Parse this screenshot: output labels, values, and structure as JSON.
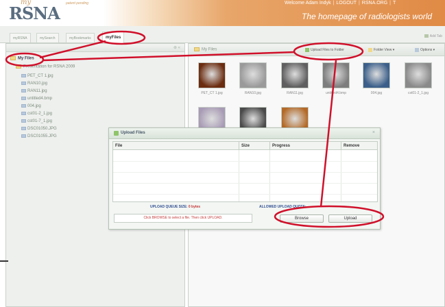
{
  "header": {
    "logo_my": "my",
    "logo_rsna": "RSNA",
    "patent": "patent pending",
    "welcome": "Welcome Adam Indyk",
    "logout": "LOGOUT",
    "rsna_org": "RSNA.ORG",
    "more": "T",
    "tagline": "The homepage of radiologists world"
  },
  "tabs": [
    {
      "label": "myRSNA"
    },
    {
      "label": "mySearch"
    },
    {
      "label": "myBookmarks"
    },
    {
      "label": "myFiles"
    }
  ],
  "add_tab": "Add Tab",
  "left_panel": {
    "root": "My Files",
    "folder": "Presentation for RSNA 2009",
    "files": [
      "PET_CT 1.jpg",
      "RAN10.jpg",
      "RAN11.jpg",
      "untitled4.bmp",
      "004.jpg",
      "cst01-2_1.jpg",
      "cst01-7_1.jpg",
      "DSC01050.JPG",
      "DSC01055.JPG"
    ]
  },
  "right_panel": {
    "title": "My Files",
    "upload_button": "Upload Files to Folder",
    "folder_view": "Folder View",
    "options": "Options",
    "thumbnails": [
      {
        "caption": "PET_CT 1.jpg",
        "color": "#6b2c10"
      },
      {
        "caption": "RAN10.jpg",
        "color": "#9a9a9a"
      },
      {
        "caption": "RAN11.jpg",
        "color": "#5f5f5f"
      },
      {
        "caption": "untitled4.bmp",
        "color": "#7d7d7d"
      },
      {
        "caption": "004.jpg",
        "color": "#3b5f8a"
      },
      {
        "caption": "cst01-2_1.jpg",
        "color": "#8a8a8a"
      },
      {
        "caption": "",
        "color": "#a89bb5"
      },
      {
        "caption": "",
        "color": "#4a4a4a"
      },
      {
        "caption": "",
        "color": "#b36a28"
      }
    ]
  },
  "dialog": {
    "title": "Upload Files",
    "columns": [
      "File",
      "Size",
      "Progress",
      "Remove"
    ],
    "queue_label": "UPLOAD QUEUE SIZE:",
    "queue_value": "0 bytes",
    "allowed_label": "ALLOWED UPLOAD QUOTA:",
    "allowed_value": "",
    "status": "Click BROWSE to select a file. Then click UPLOAD.",
    "browse": "Browse",
    "upload": "Upload"
  },
  "colors": {
    "annotation": "#d0102a",
    "header_orange": "#e08a45",
    "accent_blue": "#2f4d90"
  }
}
